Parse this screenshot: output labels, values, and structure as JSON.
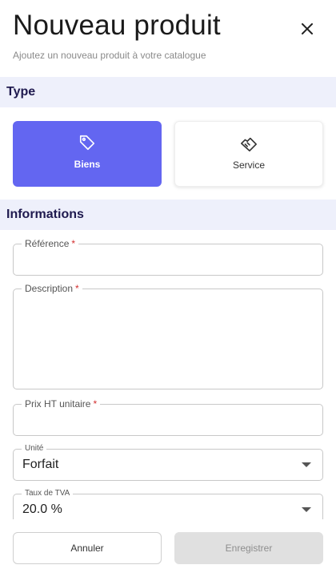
{
  "header": {
    "title": "Nouveau produit",
    "subtitle": "Ajoutez un nouveau produit à votre catalogue",
    "close_icon": "close-icon"
  },
  "sections": {
    "type": "Type",
    "informations": "Informations"
  },
  "type_options": [
    {
      "label": "Biens",
      "icon": "tag-icon",
      "selected": true
    },
    {
      "label": "Service",
      "icon": "handshake-icon",
      "selected": false
    }
  ],
  "fields": {
    "reference": {
      "label": "Référence",
      "required_mark": "*",
      "value": ""
    },
    "description": {
      "label": "Description",
      "required_mark": "*",
      "value": ""
    },
    "prix": {
      "label": "Prix HT unitaire",
      "required_mark": "*",
      "value": ""
    },
    "unite": {
      "label": "Unité",
      "value": "Forfait"
    },
    "tva": {
      "label": "Taux de TVA",
      "value": "20.0 %"
    }
  },
  "footer": {
    "cancel_label": "Annuler",
    "save_label": "Enregistrer"
  },
  "colors": {
    "accent": "#6366f1",
    "section_bg": "#eef0fb",
    "section_text": "#1f1a4f",
    "required": "#d32f2f",
    "disabled_bg": "#e0e0e0"
  }
}
